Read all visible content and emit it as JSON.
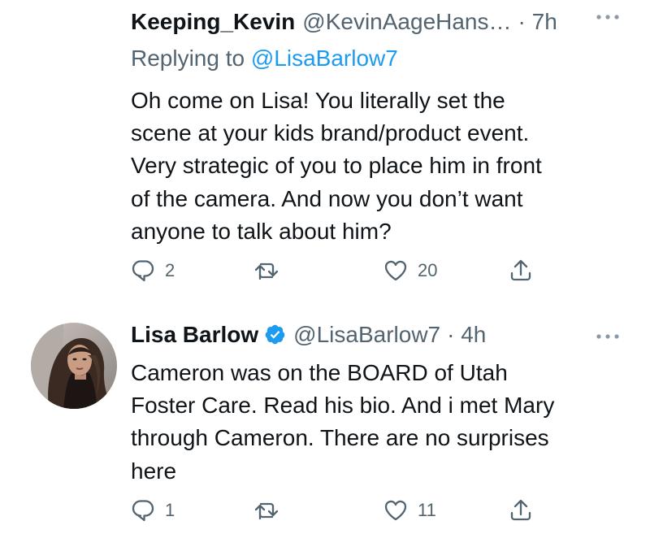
{
  "tweets": [
    {
      "display_name": "Keeping_Kevin",
      "handle": "@KevinAageHans…",
      "time": "· 7h",
      "replying_prefix": "Replying to",
      "replying_handle": "@LisaBarlow7",
      "text": "Oh come on Lisa! You literally set the\nscene at your kids brand/product event.\nVery strategic of you to place him in front\nof the camera. And now you don’t want\nanyone to talk about him?",
      "replies": "2",
      "retweets": "",
      "likes": "20",
      "icons": [
        "more-icon",
        "reply-icon",
        "retweet-icon",
        "like-icon",
        "share-icon"
      ]
    },
    {
      "display_name": "Lisa Barlow",
      "verified": true,
      "handle": "@LisaBarlow7",
      "time": "· 4h",
      "text": "Cameron was on the BOARD of Utah\nFoster Care. Read his bio. And i met Mary\nthrough Cameron. There are no surprises\nhere",
      "replies": "1",
      "retweets": "",
      "likes": "11",
      "icons": [
        "avatar",
        "verified-badge-icon",
        "more-icon",
        "reply-icon",
        "retweet-icon",
        "like-icon",
        "share-icon"
      ]
    }
  ],
  "colors": {
    "text": "#0f1419",
    "secondary": "#536471",
    "link": "#1d9bf0",
    "verified": "#1d9bf0"
  }
}
